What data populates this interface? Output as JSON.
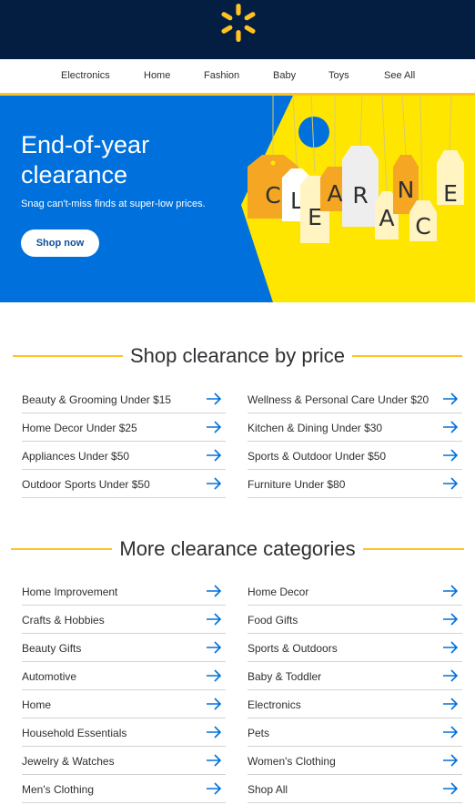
{
  "brand": {
    "logo_icon": "walmart-spark-icon",
    "bar_color": "#041e42",
    "spark_color": "#ffc220"
  },
  "nav": {
    "items": [
      "Electronics",
      "Home",
      "Fashion",
      "Baby",
      "Toys",
      "See All"
    ]
  },
  "hero": {
    "title": "End-of-year clearance",
    "subtitle": "Snag can't-miss finds at super-low prices.",
    "cta": "Shop now",
    "tag_letters": [
      "C",
      "L",
      "E",
      "A",
      "R",
      "A",
      "N",
      "C",
      "E"
    ],
    "background_color": "#0071dc",
    "tag_color": "#ffe600"
  },
  "price_section": {
    "title": "Shop clearance by price",
    "left": [
      "Beauty & Grooming Under $15",
      "Home Decor Under $25",
      "Appliances Under $50",
      "Outdoor Sports Under $50"
    ],
    "right": [
      "Wellness & Personal Care Under $20",
      "Kitchen & Dining Under $30",
      "Sports & Outdoor Under $50",
      "Furniture Under $80"
    ]
  },
  "categories_section": {
    "title": "More clearance categories",
    "left": [
      "Home Improvement",
      "Crafts & Hobbies",
      "Beauty Gifts",
      "Automotive",
      "Home",
      "Household Essentials",
      "Jewelry & Watches",
      "Men's Clothing"
    ],
    "right": [
      "Home Decor",
      "Food Gifts",
      "Sports & Outdoors",
      "Baby & Toddler",
      "Electronics",
      "Pets",
      "Women's Clothing",
      "Shop All"
    ]
  },
  "accent_color": "#ffc220",
  "arrow_icon": "arrow-right-icon"
}
